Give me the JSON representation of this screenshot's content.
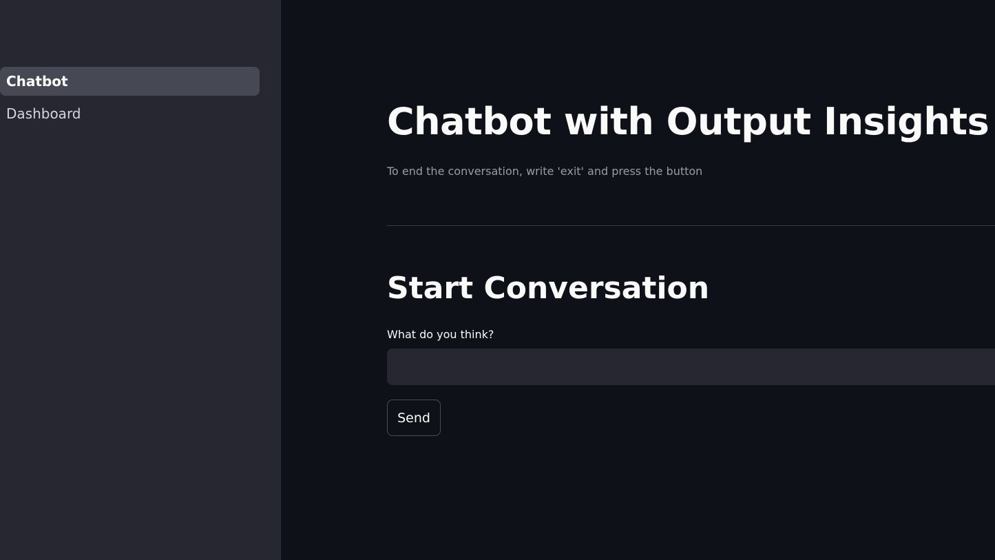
{
  "sidebar": {
    "items": [
      {
        "label": "Chatbot",
        "active": true
      },
      {
        "label": "Dashboard",
        "active": false
      }
    ]
  },
  "main": {
    "title": "Chatbot with Output Insights",
    "caption": "To end the conversation, write 'exit' and press the button",
    "subheading": "Start Conversation",
    "input": {
      "label": "What do you think?",
      "value": "",
      "placeholder": ""
    },
    "send_label": "Send"
  },
  "colors": {
    "background": "#0e1117",
    "sidebar": "#262730",
    "active_item": "#464853",
    "text": "#fafafa",
    "muted_text": "#9a9ca6"
  }
}
